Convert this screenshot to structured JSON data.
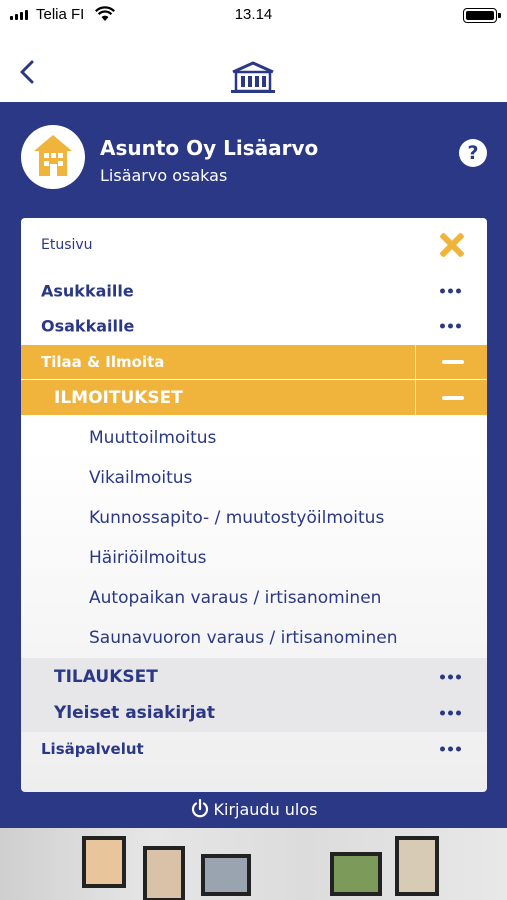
{
  "status_bar": {
    "carrier": "Telia FI",
    "time": "13.14"
  },
  "colors": {
    "brand_blue": "#2a3886",
    "accent_orange": "#f0b43c"
  },
  "account": {
    "title": "Asunto Oy Lisäarvo",
    "subtitle": "Lisäarvo osakas",
    "help_label": "?"
  },
  "menu": {
    "home": "Etusivu",
    "residents": "Asukkaille",
    "shareholders": "Osakkaille",
    "order_notify": "Tilaa & Ilmoita",
    "notifications": "ILMOITUKSET",
    "notification_items": [
      "Muuttoilmoitus",
      "Vikailmoitus",
      "Kunnossapito- / muutostyöilmoitus",
      "Häiriöilmoitus",
      "Autopaikan varaus / irtisanominen",
      "Saunavuoron varaus / irtisanominen"
    ],
    "orders": "TILAUKSET",
    "general_documents": "Yleiset asiakirjat",
    "additional_services": "Lisäpalvelut"
  },
  "logout_label": "Kirjaudu ulos"
}
